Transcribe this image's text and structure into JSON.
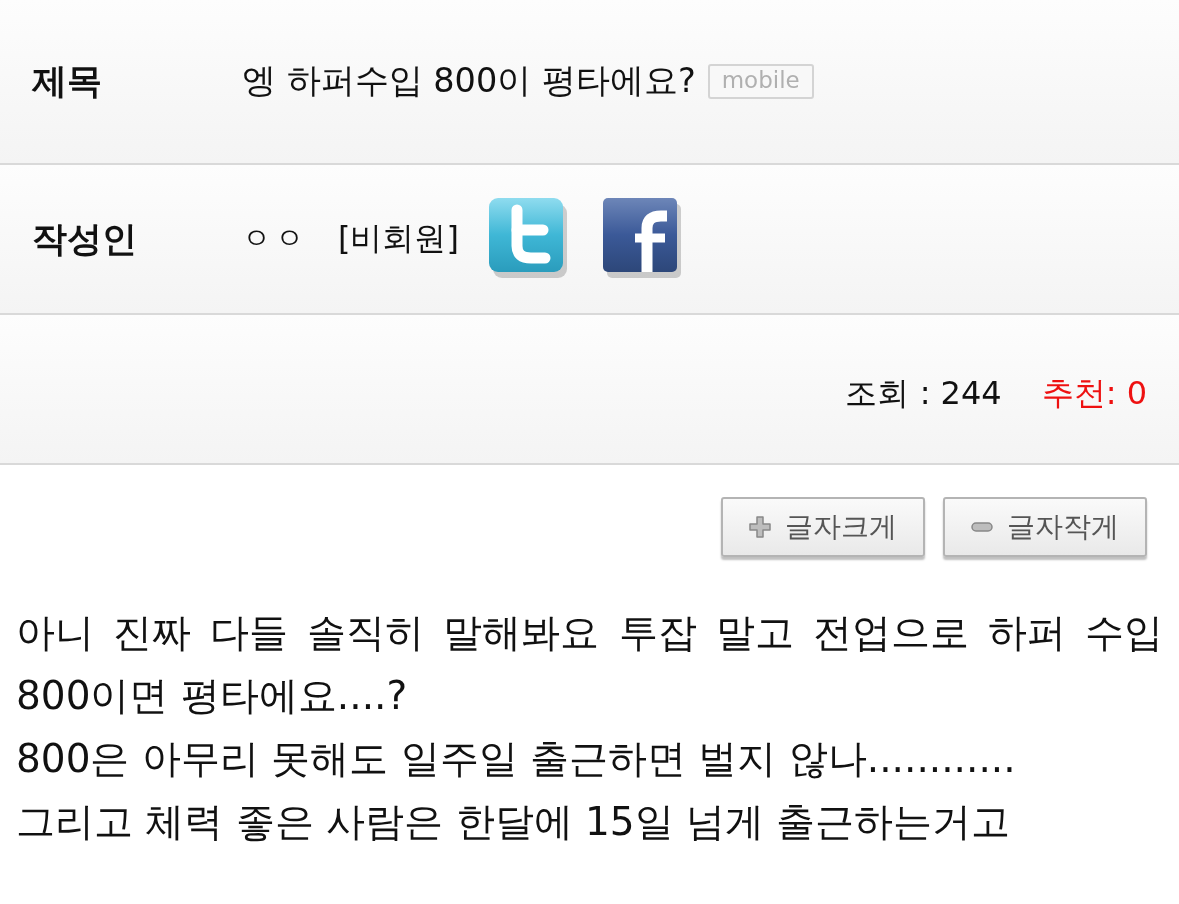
{
  "post_header": {
    "title_row": {
      "label": "제목",
      "value": "엥 하퍼수입 800이 평타에요?",
      "badge": "mobile"
    },
    "author_row": {
      "label": "작성인",
      "name": "ㅇㅇ",
      "member_status": "[비회원]",
      "share_icons": [
        {
          "kind": "twitter"
        },
        {
          "kind": "facebook"
        }
      ]
    },
    "stats": {
      "views": "조회 : 244",
      "recommend": "추천: 0"
    }
  },
  "font_buttons": [
    {
      "kind": "increase",
      "label": "글자크게"
    },
    {
      "kind": "decrease",
      "label": "글자작게"
    }
  ],
  "body": [
    "아니 진짜 다들 솔직히 말해봐요 투잡 말고 전업으로 하퍼 수입 800이면 평타에요....?",
    "800은 아무리 못해도 일주일 출근하면 벌지 않나............",
    "그리고 체력 좋은 사람은 한달에 15일 넘게 출근하는거고"
  ]
}
